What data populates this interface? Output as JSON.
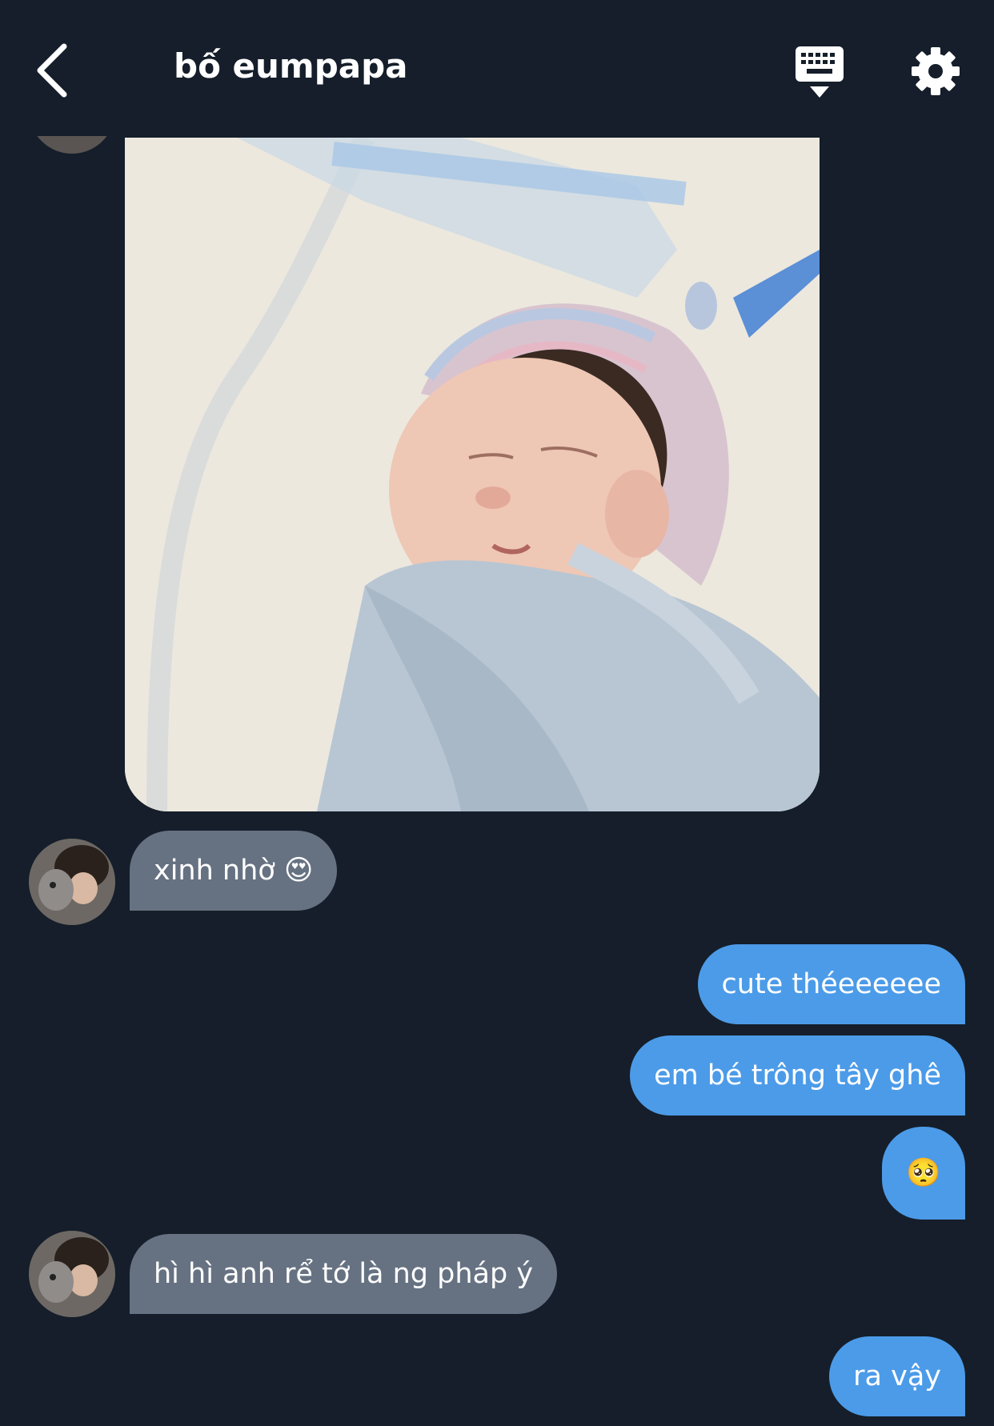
{
  "header": {
    "title": "bố eumpapa",
    "back_icon": "chevron-left-icon",
    "keyboard_icon": "keyboard-icon",
    "settings_icon": "gear-icon"
  },
  "colors": {
    "background": "#151e2a",
    "incoming_bubble": "#667282",
    "outgoing_bubble": "#4c9be8"
  },
  "messages": [
    {
      "from": "them",
      "type": "image"
    },
    {
      "from": "them",
      "text": "xinh nhờ 😍"
    },
    {
      "from": "me",
      "text": "cute théeeeeee"
    },
    {
      "from": "me",
      "text": "em bé trông tây ghê"
    },
    {
      "from": "me",
      "text": "🥺"
    },
    {
      "from": "them",
      "text": "hì hì anh rể tớ là ng pháp ý"
    },
    {
      "from": "me",
      "text": "ra vậy"
    }
  ]
}
